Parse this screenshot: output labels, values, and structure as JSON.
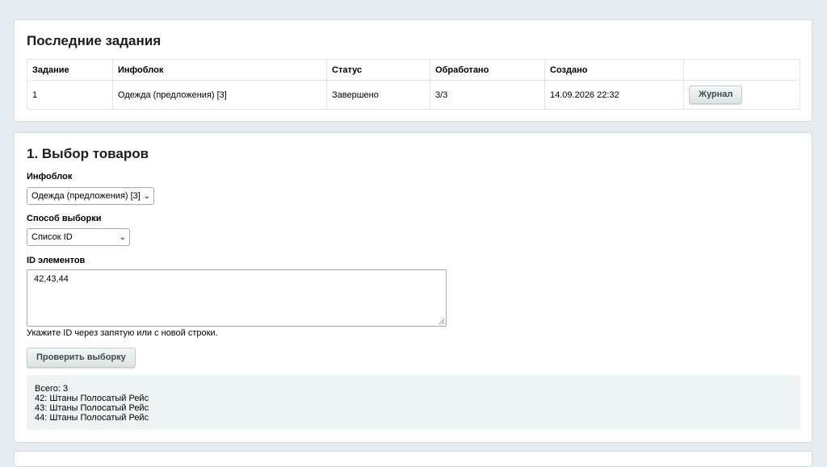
{
  "tasks": {
    "title": "Последние задания",
    "headers": [
      "Задание",
      "Инфоблок",
      "Статус",
      "Обработано",
      "Создано",
      ""
    ],
    "rows": [
      {
        "task": "1",
        "iblock": "Одежда (предложения) [3]",
        "status": "Завершено",
        "processed": "3/3",
        "created": "14.09.2026 22:32",
        "action": "Журнал"
      }
    ]
  },
  "selection": {
    "title": "1. Выбор товаров",
    "iblock_label": "Инфоблок",
    "iblock_value": "Одежда (предложения) [3]",
    "method_label": "Способ выборки",
    "method_value": "Список ID",
    "ids_label": "ID элементов",
    "ids_value": "42,43,44",
    "hint": "Укажите ID через запятую или с новой строки.",
    "check_button": "Проверить выборку",
    "result": {
      "total": "Всего: 3",
      "items": [
        "42: Штаны Полосатый Рейс",
        "43: Штаны Полосатый Рейс",
        "44: Штаны Полосатый Рейс"
      ]
    }
  }
}
